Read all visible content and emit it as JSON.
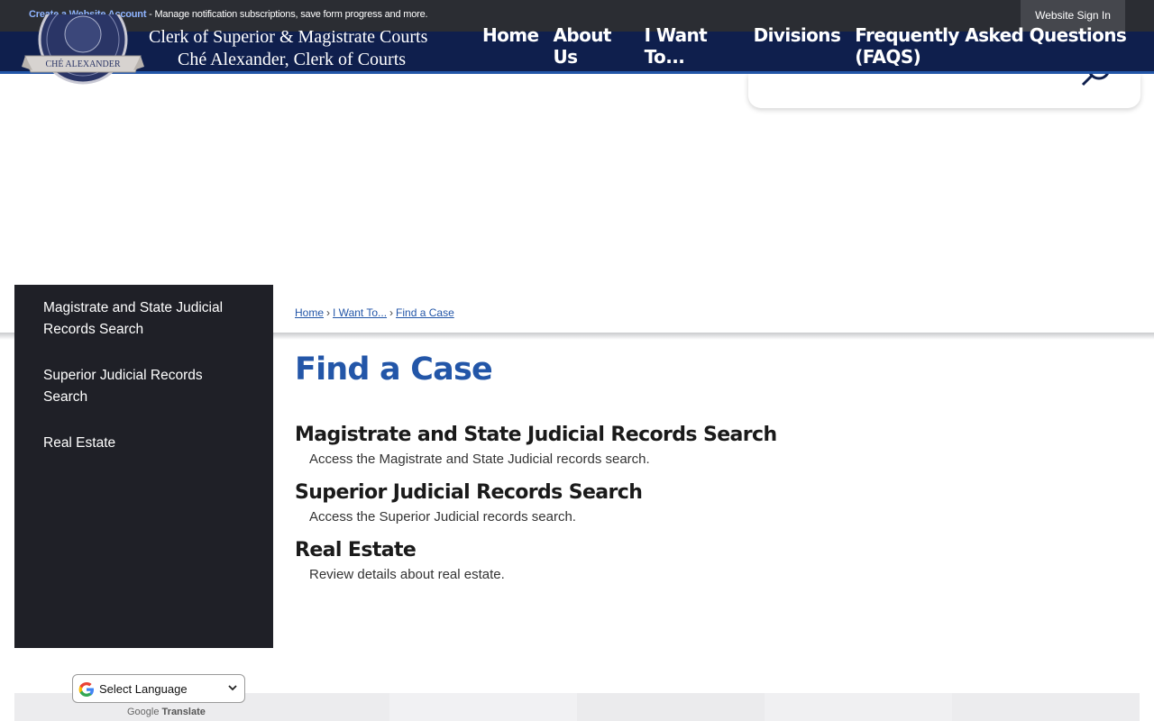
{
  "topbar": {
    "create_account": "Create a Website Account",
    "message": " - Manage notification subscriptions, save form progress and more.",
    "sign_in": "Website Sign In"
  },
  "header": {
    "title_line1": "Clerk of Superior & Magistrate Courts",
    "title_line2": "Ché Alexander, Clerk of Courts",
    "seal_text": "CHÉ ALEXANDER",
    "nav": [
      "Home",
      "About Us",
      "I Want To...",
      "Divisions",
      "Frequently Asked Questions (FAQS)"
    ]
  },
  "search": {
    "placeholder": ""
  },
  "sidebar": {
    "items": [
      "Magistrate and State Judicial Records Search",
      "Superior Judicial Records Search",
      "Real Estate"
    ]
  },
  "breadcrumb": {
    "items": [
      "Home",
      "I Want To...",
      "Find a Case"
    ]
  },
  "page": {
    "title": "Find a Case",
    "entries": [
      {
        "heading": "Magistrate and State Judicial Records Search",
        "desc": "Access the Magistrate and State Judicial records search."
      },
      {
        "heading": "Superior Judicial Records Search",
        "desc": "Access the Superior Judicial records search."
      },
      {
        "heading": "Real Estate",
        "desc": "Review details about real estate."
      }
    ]
  },
  "translate": {
    "select_label": "Select Language",
    "powered_google": "Google",
    "powered_translate": "Translate"
  },
  "colors": {
    "header_bg": "#0f1f4d",
    "accent": "#2356a8",
    "sidebar_bg": "#1f2027",
    "topbar_bg": "#2b2d33"
  }
}
